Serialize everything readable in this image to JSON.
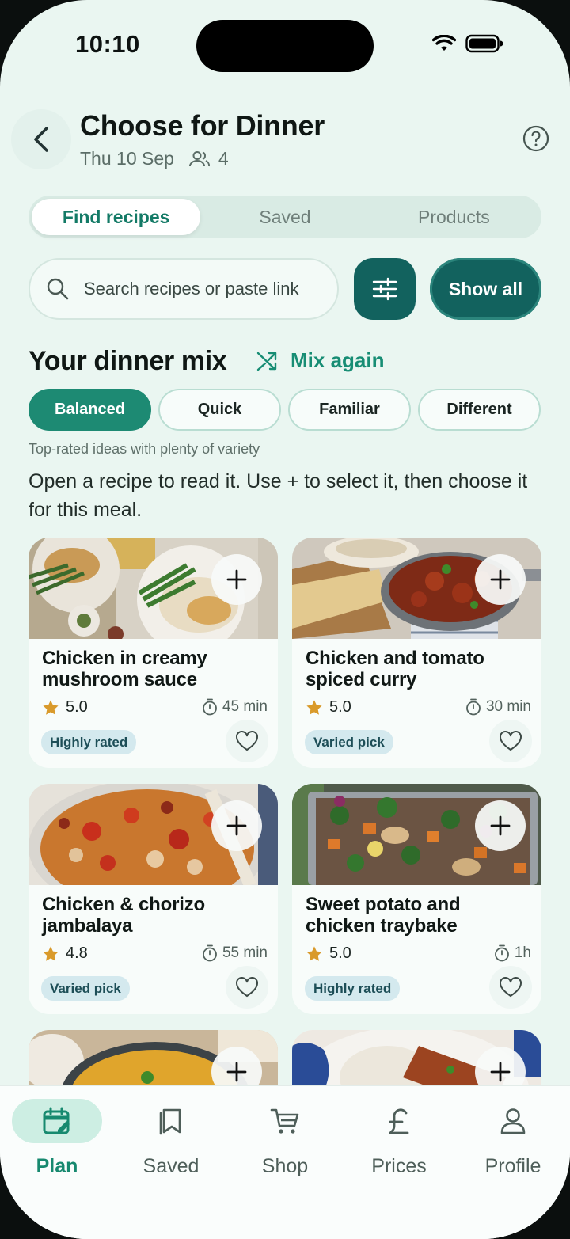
{
  "status": {
    "time": "10:10"
  },
  "header": {
    "title": "Choose for Dinner",
    "date": "Thu 10 Sep",
    "people": "4"
  },
  "tabs": [
    {
      "label": "Find recipes",
      "active": true
    },
    {
      "label": "Saved",
      "active": false
    },
    {
      "label": "Products",
      "active": false
    }
  ],
  "search": {
    "placeholder": "Search recipes or paste link",
    "value": ""
  },
  "show_all_label": "Show all",
  "mix": {
    "title": "Your dinner mix",
    "action": "Mix again",
    "chips": [
      {
        "label": "Balanced",
        "active": true
      },
      {
        "label": "Quick",
        "active": false
      },
      {
        "label": "Familiar",
        "active": false
      },
      {
        "label": "Different",
        "active": false
      }
    ],
    "hint": "Top-rated ideas with plenty of variety",
    "instructions": "Open a recipe to read it. Use + to select it, then choose it for this meal."
  },
  "recipes": [
    {
      "name": "Chicken in creamy mushroom sauce",
      "rating": "5.0",
      "time": "45 min",
      "badge": "Highly rated"
    },
    {
      "name": "Chicken and tomato spiced curry",
      "rating": "5.0",
      "time": "30 min",
      "badge": "Varied pick"
    },
    {
      "name": "Chicken & chorizo jambalaya",
      "rating": "4.8",
      "time": "55 min",
      "badge": "Varied pick"
    },
    {
      "name": "Sweet potato and chicken traybake",
      "rating": "5.0",
      "time": "1h",
      "badge": "Highly rated"
    }
  ],
  "nav": [
    {
      "label": "Plan",
      "icon": "calendar-edit-icon",
      "active": true
    },
    {
      "label": "Saved",
      "icon": "bookmark-icon",
      "active": false
    },
    {
      "label": "Shop",
      "icon": "cart-icon",
      "active": false
    },
    {
      "label": "Prices",
      "icon": "pound-icon",
      "active": false
    },
    {
      "label": "Profile",
      "icon": "person-icon",
      "active": false
    }
  ],
  "colors": {
    "accent": "#17896f",
    "dark_teal": "#12625e",
    "background": "#eaf6f1"
  }
}
